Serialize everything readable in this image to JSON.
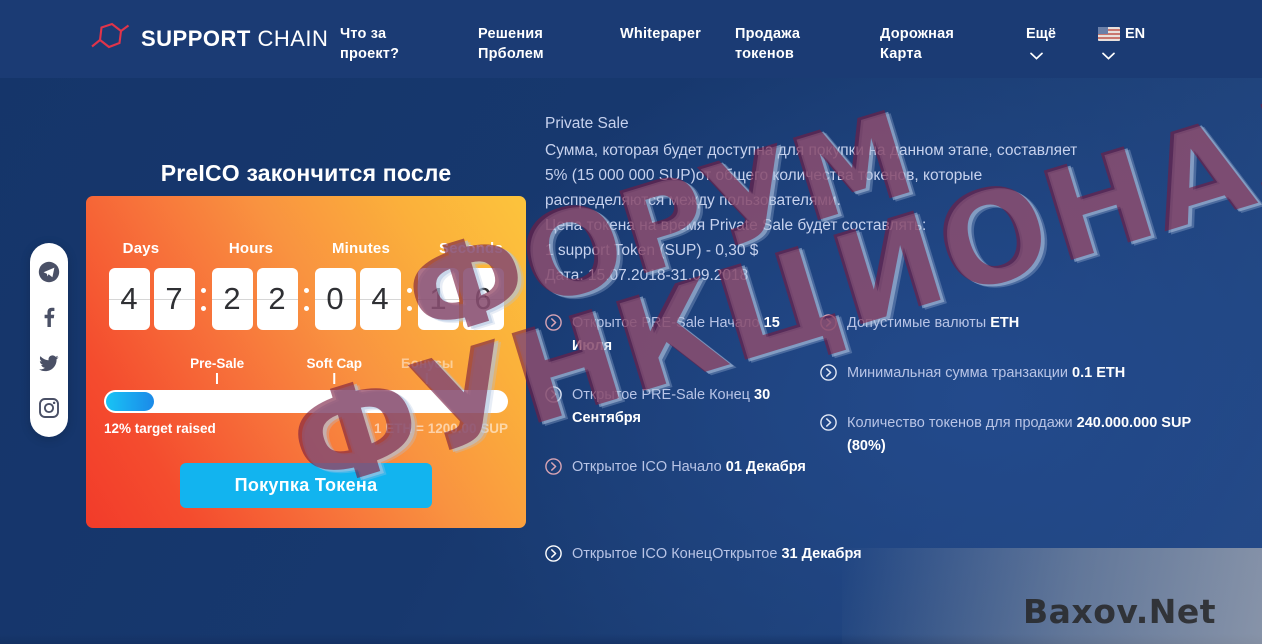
{
  "nav": {
    "logo": {
      "icon": "hexagon-molecule-icon",
      "strong": "SUPPORT",
      "light": "CHAIN"
    },
    "links": [
      {
        "label": "Что за\nпроект?"
      },
      {
        "label": "Решения\nПрболем"
      },
      {
        "label": "Whitepaper"
      },
      {
        "label": "Продажа\nтокенов"
      },
      {
        "label": "Дорожная\nКарта"
      }
    ],
    "more": {
      "label": "Ещё",
      "icon": "chevron-down-icon"
    },
    "language": {
      "label": "EN",
      "flag": "us-flag-icon",
      "icon": "chevron-down-icon"
    }
  },
  "social": [
    {
      "name": "telegram-icon"
    },
    {
      "name": "facebook-icon"
    },
    {
      "name": "twitter-icon"
    },
    {
      "name": "instagram-icon"
    }
  ],
  "countdown": {
    "heading": "PreICO закончится после",
    "labels": [
      "Days",
      "Hours",
      "Minutes",
      "Seconds"
    ],
    "days": [
      "4",
      "7"
    ],
    "hours": [
      "2",
      "2"
    ],
    "minutes": [
      "0",
      "4"
    ],
    "seconds": [
      "1",
      "6"
    ]
  },
  "progress": {
    "ticks": [
      {
        "label": "Pre-Sale",
        "pos_pct": 28
      },
      {
        "label": "Soft Cap",
        "pos_pct": 57
      },
      {
        "label": "Бонусы",
        "pos_pct": 80
      }
    ],
    "fill_pct": 12,
    "raised_text": "12% target raised",
    "rate_text": "1 ETH = 1200.00 SUP"
  },
  "buy_button": {
    "label_1": "Покупка ",
    "label_2": "Токена",
    "label_full": "Покупка Токена",
    "color": "#12b4ef"
  },
  "info": {
    "title": "Private Sale",
    "lines": [
      "Сумма, которая будет доступна для покупки на данном этапе, составляет",
      "5% (15 000 000 SUP)от общего количества токенов, которые",
      "распределяются между пользователями.",
      "Цена токена на время Private Sale будет составлять:",
      "1 support Token (SUP) - 0,30 $",
      "Дата: 15.07.2018-31.09.2018"
    ]
  },
  "bullets_left": [
    {
      "text": "Открытое PRE-Sale Начало ",
      "bold": "15 Июля",
      "icon": "chevron-circle-right-icon"
    },
    {
      "text": "Открытое PRE-Sale Конец ",
      "bold": "30 Сентября",
      "icon": "chevron-circle-right-icon"
    },
    {
      "text": "Открытое ICO Начало ",
      "bold": "01 Декабря",
      "icon": "chevron-circle-right-icon"
    }
  ],
  "bullets_right": [
    {
      "text": "Допустимые валюты ",
      "bold": "ETH",
      "icon": "chevron-circle-right-icon"
    },
    {
      "text": "Минимальная сумма транзакции ",
      "bold": "0.1 ETH",
      "icon": "chevron-circle-right-icon"
    },
    {
      "text": "Количество токенов для продажи ",
      "bold": "240.000.000 SUP (80%)",
      "icon": "chevron-circle-right-icon"
    }
  ],
  "bullet_last": {
    "text": "Открытое ICO КонецОткрытое ",
    "bold": "31 Декабря",
    "icon": "chevron-circle-right-icon"
  },
  "watermark": {
    "stamp_top": "ФОРУМ",
    "stamp_bottom": "ФУНКЦИОНАЛ",
    "brand": "Baxov.Net"
  },
  "colors": {
    "page_bg": "#17386e",
    "nav_bg": "#1b3b74",
    "card_gradient_start": "#f23b2a",
    "card_gradient_end": "#fcc43c",
    "accent_blue": "#12b4ef",
    "logo_red": "#e0344a",
    "text_muted": "#c7d2ee"
  }
}
